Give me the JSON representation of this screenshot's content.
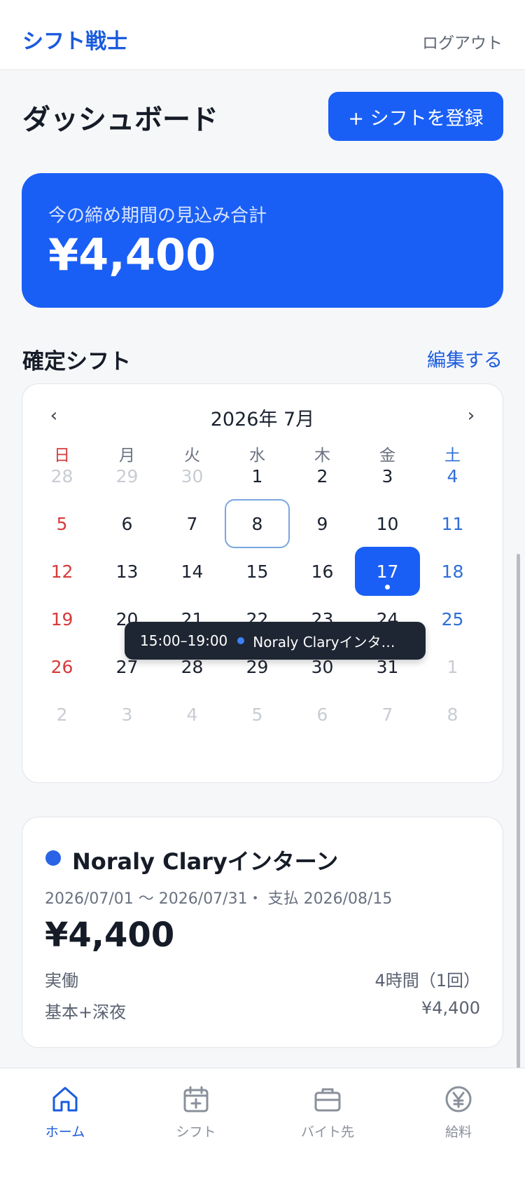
{
  "header": {
    "brand": "シフト戦士",
    "logout_label": "ログアウト"
  },
  "page": {
    "title": "ダッシュボード",
    "add_shift_label": "+ シフトを登録"
  },
  "summary": {
    "label": "今の締め期間の見込み合計",
    "amount": "¥4,400"
  },
  "confirmed_section": {
    "title": "確定シフト",
    "edit_label": "編集する"
  },
  "calendar": {
    "prev": "‹",
    "next": "›",
    "month_label": "2026年 7月",
    "weekdays": [
      "日",
      "月",
      "火",
      "水",
      "木",
      "金",
      "土"
    ],
    "days": [
      [
        "28",
        "29",
        "30",
        "1",
        "2",
        "3",
        "4"
      ],
      [
        "5",
        "6",
        "7",
        "8",
        "9",
        "10",
        "11"
      ],
      [
        "12",
        "13",
        "14",
        "15",
        "16",
        "17",
        "18"
      ],
      [
        "19",
        "20",
        "21",
        "22",
        "23",
        "24",
        "25"
      ],
      [
        "26",
        "27",
        "28",
        "29",
        "30",
        "31",
        "1"
      ],
      [
        "2",
        "3",
        "4",
        "5",
        "6",
        "7",
        "8"
      ]
    ],
    "today": "8",
    "selected": "17",
    "tooltip": {
      "time": "15:00–19:00",
      "text": "Noraly Claryインタ…"
    }
  },
  "job": {
    "name": "Noraly Claryインターン",
    "period": "2026/07/01 〜 2026/07/31・ 支払 2026/08/15",
    "amount": "¥4,400",
    "rows": [
      {
        "label": "実働",
        "value": "4時間（1回）"
      },
      {
        "label": "基本+深夜",
        "value": "¥4,400"
      }
    ],
    "dot_color": "#2a63e6"
  },
  "nav": {
    "items": [
      {
        "label": "ホーム",
        "icon": "home-icon",
        "active": true
      },
      {
        "label": "シフト",
        "icon": "calendar-plus-icon",
        "active": false
      },
      {
        "label": "バイト先",
        "icon": "briefcase-icon",
        "active": false
      },
      {
        "label": "給料",
        "icon": "yen-icon",
        "active": false
      }
    ]
  },
  "colors": {
    "accent": "#1a5ff5",
    "sunday": "#d63b3b",
    "saturday": "#2f6fd8"
  }
}
